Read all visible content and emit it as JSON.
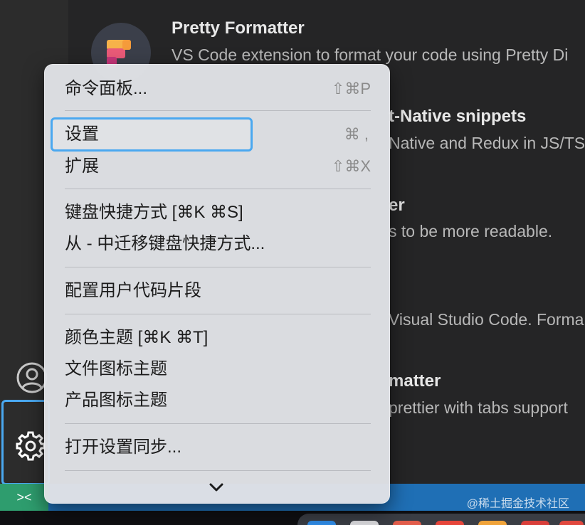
{
  "extensions": [
    {
      "title": "Pretty Formatter",
      "description": "VS Code extension to format your code using Pretty Di"
    },
    {
      "title": "t-Native snippets",
      "description": "Native and Redux in JS/TS"
    },
    {
      "title": "er",
      "description": "s to be more readable."
    },
    {
      "title": "",
      "description": "Visual Studio Code. Forma"
    },
    {
      "title": "matter",
      "description": "prettier with tabs support"
    }
  ],
  "menu": {
    "items": [
      {
        "label": "命令面板...",
        "shortcut": "⇧⌘P"
      },
      {
        "label": "设置",
        "shortcut": "⌘ ,"
      },
      {
        "label": "扩展",
        "shortcut": "⇧⌘X"
      },
      {
        "label": "键盘快捷方式 [⌘K ⌘S]",
        "shortcut": ""
      },
      {
        "label": "从 - 中迁移键盘快捷方式...",
        "shortcut": ""
      },
      {
        "label": "配置用户代码片段",
        "shortcut": ""
      },
      {
        "label": "颜色主题 [⌘K ⌘T]",
        "shortcut": ""
      },
      {
        "label": "文件图标主题",
        "shortcut": ""
      },
      {
        "label": "产品图标主题",
        "shortcut": ""
      },
      {
        "label": "打开设置同步...",
        "shortcut": ""
      }
    ],
    "more_icon": "chevron-down-icon"
  },
  "activity_bar": {
    "account_icon": "account-icon",
    "manage_icon": "gear-icon"
  },
  "status_bar": {
    "remote_label": "><",
    "watermark": "@稀土掘金技术社区"
  },
  "colors": {
    "highlight": "#4aa8f0",
    "status_bar": "#1f6fb5",
    "remote": "#2e9d6e"
  }
}
